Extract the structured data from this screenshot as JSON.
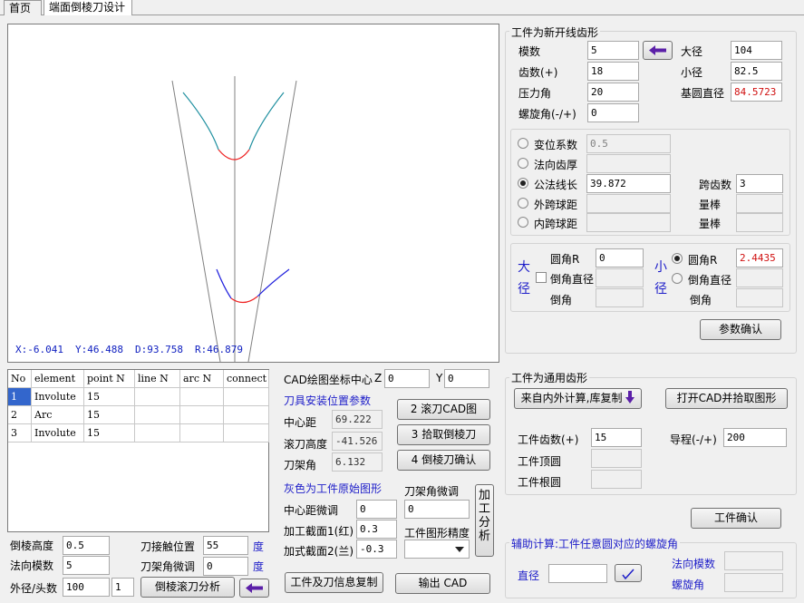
{
  "tabs": [
    "首页",
    "端面倒棱刀设计"
  ],
  "canvas": {
    "coords": {
      "x": "X:-6.041",
      "y": "Y:46.488",
      "d": "D:93.758",
      "r": "R:46.879"
    }
  },
  "grid": {
    "headers": [
      "No",
      "element",
      "point N",
      "line N",
      "arc N",
      "connect"
    ],
    "rows": [
      [
        "1",
        "Involute",
        "15",
        "",
        "",
        ""
      ],
      [
        "2",
        "Arc",
        "15",
        "",
        "",
        ""
      ],
      [
        "3",
        "Involute",
        "15",
        "",
        "",
        ""
      ]
    ]
  },
  "bottom_left": {
    "chamfer_height_label": "倒棱高度",
    "chamfer_height": "0.5",
    "normal_module_label": "法向模数",
    "normal_module": "5",
    "od_starts_label": "外径/头数",
    "od": "100",
    "starts": "1",
    "holder_pos_label": "刀接触位置",
    "holder_pos": "55",
    "holder_pos_unit": "度",
    "holder_adj_label": "刀架角微调",
    "holder_adj": "0",
    "holder_adj_unit": "度",
    "analysis_button": "倒棱滚刀分析"
  },
  "middle": {
    "cad_center_label": "CAD绘图坐标中心",
    "z_label": "Z",
    "z_value": "0",
    "y_label": "Y",
    "y_value": "0",
    "install_title": "刀具安装位置参数",
    "center_dist_label": "中心距",
    "center_dist": "69.222",
    "hob_height_label": "滚刀高度",
    "hob_height": "-41.526",
    "holder_angle_label": "刀架角",
    "holder_angle": "6.132",
    "btn_hob_cad": "2  滚刀CAD图",
    "btn_pick": "3 拾取倒棱刀",
    "btn_confirm": "4 倒棱刀确认",
    "gray_title": "灰色为工件原始图形",
    "center_adj_label": "中心距微调",
    "center_adj": "0",
    "sec1_label": "加工截面1(红)",
    "sec1": "0.3",
    "sec2_label": "加式截面2(兰)",
    "sec2": "-0.3",
    "holder_fine_label": "刀架角微调",
    "holder_fine": "0",
    "precision_label": "工件图形精度",
    "vbtn": "加工分析",
    "btn_copy": "工件及刀信息复制",
    "btn_export": "输出 CAD"
  },
  "involute_group": {
    "title": "工件为新开线齿形",
    "module_label": "模数",
    "module": "5",
    "teeth_label": "齿数(+)",
    "teeth": "18",
    "pressure_label": "压力角",
    "pressure": "20",
    "helix_label": "螺旋角(-/+)",
    "helix": "0",
    "major_label": "大径",
    "major": "104",
    "minor_label": "小径",
    "minor": "82.5",
    "base_label": "基圆直径",
    "base": "84.5723",
    "shift_label": "变位系数",
    "shift": "0.5",
    "normal_thick_label": "法向齿厚",
    "normal_thick": "",
    "wk_label": "公法线长",
    "wk": "39.872",
    "span_label": "跨齿数",
    "span": "3",
    "ext_ball_label": "外跨球距",
    "ext_ball": "",
    "int_ball_label": "内跨球距",
    "int_ball": "",
    "rod1_label": "量棒",
    "rod2_label": "量棒",
    "big_label": "大径",
    "small_label": "小径",
    "fillet_r_label": "圆角R",
    "fillet_r_big": "0",
    "fillet_r_small": "2.4435",
    "chamfer_d_label": "倒角直径",
    "chamfer_label": "倒角",
    "param_confirm": "参数确认"
  },
  "general_group": {
    "title": "工件为通用齿形",
    "btn_internal": "来自内外计算,库复制",
    "btn_open_cad": "打开CAD并拾取图形",
    "teeth_label": "工件齿数(+)",
    "teeth": "15",
    "lead_label": "导程(-/+)",
    "lead": "200",
    "tip_label": "工件顶圆",
    "root_label": "工件根圆",
    "confirm": "工件确认"
  },
  "aux_group": {
    "title": "辅助计算:工件任意圆对应的螺旋角",
    "dia_label": "直径",
    "dia": "",
    "nm_label": "法向模数",
    "helix_label": "螺旋角"
  }
}
